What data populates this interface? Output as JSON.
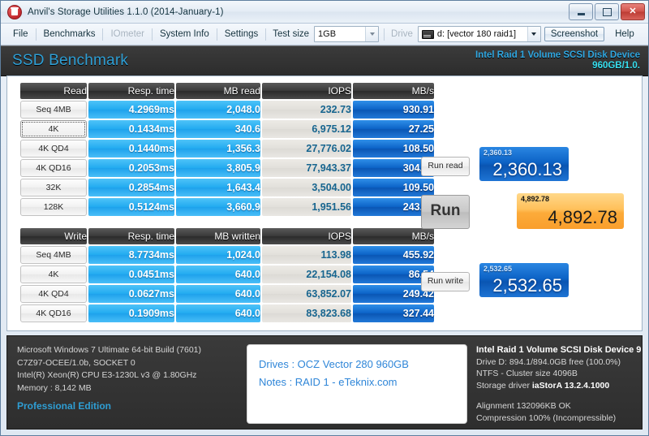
{
  "window": {
    "title": "Anvil's Storage Utilities 1.1.0 (2014-January-1)",
    "icon": "anvil-icon",
    "minimize_label": "–",
    "maximize_label": "□",
    "close_label": "✕"
  },
  "menu": {
    "items": [
      {
        "label": "File",
        "disabled": false
      },
      {
        "label": "Benchmarks",
        "disabled": false
      },
      {
        "label": "IOmeter",
        "disabled": true
      },
      {
        "label": "System Info",
        "disabled": false
      },
      {
        "label": "Settings",
        "disabled": false
      }
    ],
    "test_size_label": "Test size",
    "test_size_value": "1GB",
    "drive_label": "Drive",
    "drive_value": "d: [vector 180 raid1]",
    "screenshot_label": "Screenshot",
    "help_label": "Help"
  },
  "header": {
    "title": "SSD Benchmark",
    "device": "Intel Raid 1 Volume SCSI Disk Device",
    "capacity": "960GB/1.0."
  },
  "read_table": {
    "headers": [
      "Read",
      "Resp. time",
      "MB read",
      "IOPS",
      "MB/s"
    ],
    "rows": [
      {
        "label": "Seq 4MB",
        "selected": false,
        "resp": "4.2969ms",
        "mb": "2,048.0",
        "iops": "232.73",
        "mbs": "930.91"
      },
      {
        "label": "4K",
        "selected": true,
        "resp": "0.1434ms",
        "mb": "340.6",
        "iops": "6,975.12",
        "mbs": "27.25"
      },
      {
        "label": "4K QD4",
        "selected": false,
        "resp": "0.1440ms",
        "mb": "1,356.3",
        "iops": "27,776.02",
        "mbs": "108.50"
      },
      {
        "label": "4K QD16",
        "selected": false,
        "resp": "0.2053ms",
        "mb": "3,805.9",
        "iops": "77,943.37",
        "mbs": "304.47"
      },
      {
        "label": "32K",
        "selected": false,
        "resp": "0.2854ms",
        "mb": "1,643.4",
        "iops": "3,504.00",
        "mbs": "109.50"
      },
      {
        "label": "128K",
        "selected": false,
        "resp": "0.5124ms",
        "mb": "3,660.9",
        "iops": "1,951.56",
        "mbs": "243.94"
      }
    ]
  },
  "write_table": {
    "headers": [
      "Write",
      "Resp. time",
      "MB written",
      "IOPS",
      "MB/s"
    ],
    "rows": [
      {
        "label": "Seq 4MB",
        "selected": false,
        "resp": "8.7734ms",
        "mb": "1,024.0",
        "iops": "113.98",
        "mbs": "455.92"
      },
      {
        "label": "4K",
        "selected": false,
        "resp": "0.0451ms",
        "mb": "640.0",
        "iops": "22,154.08",
        "mbs": "86.54"
      },
      {
        "label": "4K QD4",
        "selected": false,
        "resp": "0.0627ms",
        "mb": "640.0",
        "iops": "63,852.07",
        "mbs": "249.42"
      },
      {
        "label": "4K QD16",
        "selected": false,
        "resp": "0.1909ms",
        "mb": "640.0",
        "iops": "83,823.68",
        "mbs": "327.44"
      }
    ]
  },
  "scores": {
    "run_read_label": "Run read",
    "run_label": "Run",
    "run_write_label": "Run write",
    "read_score": "2,360.13",
    "read_score_mini": "2,360.13",
    "total_score": "4,892.78",
    "total_score_mini": "4,892.78",
    "write_score": "2,532.65",
    "write_score_mini": "2,532.65"
  },
  "system_info": {
    "os": "Microsoft Windows 7 Ultimate  64-bit Build (7601)",
    "board": "C7Z97-OCEE/1.0b, SOCKET 0",
    "cpu": "Intel(R) Xeon(R) CPU E3-1230L v3 @ 1.80GHz",
    "memory": "Memory : 8,142 MB",
    "edition": "Professional Edition"
  },
  "notes": {
    "drives": "Drives : OCZ Vector 280 960GB",
    "notes": "Notes : RAID 1 - eTeknix.com"
  },
  "drive_info": {
    "name": "Intel Raid 1 Volume SCSI Disk Device 9",
    "free": "Drive D: 894.1/894.0GB free (100.0%)",
    "fs": "NTFS - Cluster size 4096B",
    "driver_label": "Storage driver",
    "driver_value": "iaStorA 13.2.4.1000",
    "alignment": "Alignment 132096KB OK",
    "compression": "Compression 100% (Incompressible)"
  },
  "colors": {
    "accent_blue": "#2e9ed4",
    "cyan": "#37e0f0",
    "score_blue": "#0d63c6",
    "score_orange": "#fcab3a",
    "resp_cell": "#21aaf0",
    "mbs_cell": "#0c64c8",
    "iops_cell": "#e2e0db",
    "iops_text": "#17658f"
  }
}
